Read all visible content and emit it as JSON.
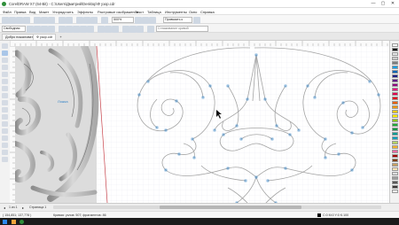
{
  "window": {
    "title": "CorelDRAW X7 (64-Bit) - C:\\Users\\Дмитрий\\Desktop\\Ф узор.cdr",
    "minimize": "—",
    "maximize": "▢",
    "close": "✕"
  },
  "menu": [
    "Файл",
    "Правка",
    "Вид",
    "Макет",
    "Упорядочить",
    "Эффекты",
    "Растровые изображения",
    "Текст",
    "Таблица",
    "Инструменты",
    "Окно",
    "Справка"
  ],
  "toolbar1": {
    "zoom": "500%",
    "snap": "Привязать к"
  },
  "toolbar2": {
    "preset": "Свободная",
    "hint": "Сглаживание кривой"
  },
  "tabs": [
    {
      "label": "Добро пожаловать!"
    },
    {
      "label": "Ф узор.cdr"
    }
  ],
  "pages": {
    "page_label": "1 из 1",
    "tab_label": "Страница 1"
  },
  "annotation": {
    "label": "Ложка"
  },
  "status": {
    "coords": "( 154,851; 137,778 )",
    "info": "Кривая: узлов: 507; фрагментов: 86",
    "color_info": "C:0 M:0 Y:0 K:100"
  },
  "palette_colors": [
    "#ffffff",
    "#000000",
    "#e6e6e6",
    "#c8c8c8",
    "#7f7f7f",
    "#00a0e9",
    "#0068b7",
    "#1d2088",
    "#601986",
    "#920783",
    "#e4007f",
    "#e5004f",
    "#e60012",
    "#eb6100",
    "#f39800",
    "#fcc800",
    "#fff100",
    "#8fc31f",
    "#22ac38",
    "#009944",
    "#009e96",
    "#00a0c1",
    "#b3d465",
    "#f7b52c",
    "#ea68a2",
    "#a40000",
    "#7d3f00",
    "#c8a063",
    "#ffe4b5",
    "#dcdcdc",
    "#9fa0a0",
    "#595757",
    "#3e3a39",
    "#eeeeee"
  ],
  "colors": {
    "outline": "#a4a4a4",
    "node": "#3a87c8",
    "accent": "#d9534f"
  }
}
